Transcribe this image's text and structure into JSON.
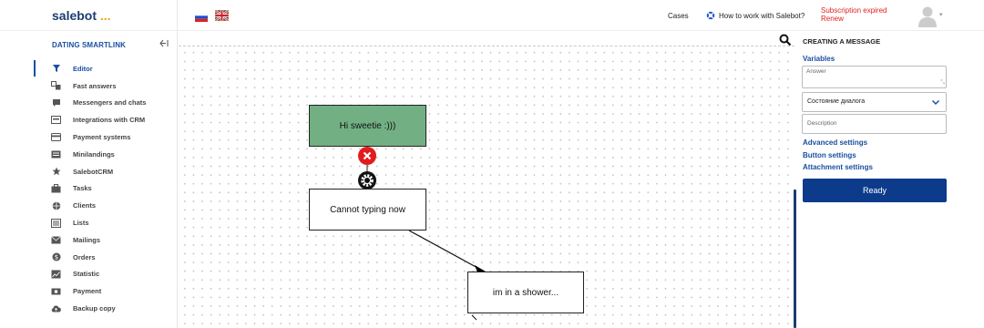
{
  "app": {
    "logo_text": "salebot",
    "logo_dots": "...",
    "project_title": "DATING SMARTLINK"
  },
  "sidebar": {
    "items": [
      {
        "label": "Editor",
        "icon": "filter-icon",
        "active": true
      },
      {
        "label": "Fast answers",
        "icon": "translate-icon"
      },
      {
        "label": "Messengers and chats",
        "icon": "chat-icon"
      },
      {
        "label": "Integrations with CRM",
        "icon": "crm-icon"
      },
      {
        "label": "Payment systems",
        "icon": "credit-card-icon"
      },
      {
        "label": "Minilandings",
        "icon": "landing-icon"
      },
      {
        "label": "SalebotCRM",
        "icon": "star-icon"
      },
      {
        "label": "Tasks",
        "icon": "briefcase-icon"
      },
      {
        "label": "Clients",
        "icon": "globe-icon"
      },
      {
        "label": "Lists",
        "icon": "list-icon"
      },
      {
        "label": "Mailings",
        "icon": "mail-icon"
      },
      {
        "label": "Orders",
        "icon": "dollar-icon"
      },
      {
        "label": "Statistic",
        "icon": "chart-icon"
      },
      {
        "label": "Payment",
        "icon": "money-icon"
      },
      {
        "label": "Backup copy",
        "icon": "cloud-upload-icon"
      }
    ]
  },
  "topbar": {
    "cases_label": "Cases",
    "howto_label": "How to work with Salebot?",
    "subscription_expired": "Subscription expired",
    "renew": "Renew"
  },
  "canvas": {
    "nodes": [
      {
        "id": "hi",
        "text": "Hi sweetie :)))"
      },
      {
        "id": "typing",
        "text": "Cannot typing now"
      },
      {
        "id": "shower",
        "text": "im in a shower..."
      }
    ]
  },
  "panel": {
    "title": "CREATING A MESSAGE",
    "variables_label": "Variables",
    "answer_placeholder": "Answer",
    "select_value": "Состояние диалога",
    "description_placeholder": "Description",
    "advanced_settings": "Advanced settings",
    "button_settings": "Button settings",
    "attachment_settings": "Attachment settings",
    "ready_label": "Ready"
  },
  "colors": {
    "accent": "#1a4fa0",
    "primary_button": "#0d3b8c",
    "node_green": "#72b083",
    "danger": "#e02020"
  }
}
